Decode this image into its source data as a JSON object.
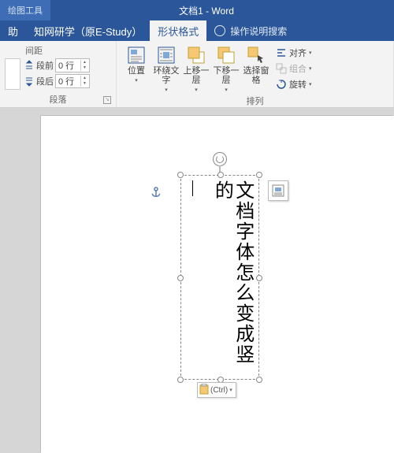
{
  "title": {
    "context_tool": "绘图工具",
    "doc": "文档1  -  Word"
  },
  "tabs": {
    "help": "助",
    "estudy": "知网研学（原E-Study）",
    "shape_format": "形状格式",
    "tell_me": "操作说明搜索"
  },
  "ribbon": {
    "spacing": {
      "header": "间距",
      "before_label": "段前",
      "before_value": "0 行",
      "after_label": "段后",
      "after_value": "0 行",
      "group": "段落"
    },
    "arrange": {
      "position": "位置",
      "wrap": "环绕文\n字",
      "forward": "上移一层",
      "backward": "下移一层",
      "select_pane": "选择窗格",
      "align": "对齐",
      "group_items": "组合",
      "rotate": "旋转",
      "group": "排列"
    }
  },
  "canvas": {
    "textbox_content": "文档字体怎么变成竖的",
    "paste_tag": "(Ctrl)"
  }
}
